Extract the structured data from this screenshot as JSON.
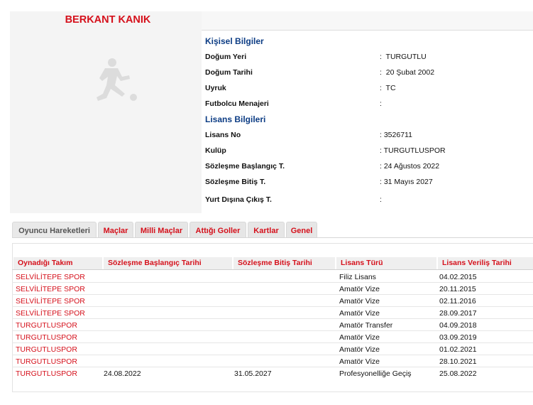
{
  "player": {
    "name": "BERKANT KANIK"
  },
  "personal": {
    "title": "Kişisel Bilgiler",
    "rows": [
      {
        "label": "Doğum Yeri",
        "value": ":  TURGUTLU"
      },
      {
        "label": "Doğum Tarihi",
        "value": ":  20 Şubat 2002"
      },
      {
        "label": "Uyruk",
        "value": ":  TC"
      },
      {
        "label": "Futbolcu Menajeri",
        "value": ":"
      }
    ]
  },
  "license": {
    "title": "Lisans Bilgileri",
    "rows": [
      {
        "label": "Lisans No",
        "value": ": 3526711"
      },
      {
        "label": "Kulüp",
        "value": ": TURGUTLUSPOR"
      },
      {
        "label": "Sözleşme Başlangıç T.",
        "value": ": 24 Ağustos 2022"
      },
      {
        "label": "Sözleşme Bitiş T.",
        "value": ": 31 Mayıs 2027"
      },
      {
        "label": "Yurt Dışına Çıkış T.",
        "value": ":"
      }
    ]
  },
  "tabs": [
    "Oyuncu Hareketleri",
    "Maçlar",
    "Milli Maçlar",
    "Attığı Goller",
    "Kartlar",
    "Genel"
  ],
  "table": {
    "headers": [
      "Oynadığı Takım",
      "Sözleşme Başlangıç Tarihi",
      "Sözleşme Bitiş Tarihi",
      "Lisans Türü",
      "Lisans Veriliş Tarihi"
    ],
    "rows": [
      [
        "SELVİLİTEPE SPOR",
        "",
        "",
        "Filiz Lisans",
        "04.02.2015"
      ],
      [
        "SELVİLİTEPE SPOR",
        "",
        "",
        "Amatör Vize",
        "20.11.2015"
      ],
      [
        "SELVİLİTEPE SPOR",
        "",
        "",
        "Amatör Vize",
        "02.11.2016"
      ],
      [
        "SELVİLİTEPE SPOR",
        "",
        "",
        "Amatör Vize",
        "28.09.2017"
      ],
      [
        "TURGUTLUSPOR",
        "",
        "",
        "Amatör Transfer",
        "04.09.2018"
      ],
      [
        "TURGUTLUSPOR",
        "",
        "",
        "Amatör Vize",
        "03.09.2019"
      ],
      [
        "TURGUTLUSPOR",
        "",
        "",
        "Amatör Vize",
        "01.02.2021"
      ],
      [
        "TURGUTLUSPOR",
        "",
        "",
        "Amatör Vize",
        "28.10.2021"
      ],
      [
        "TURGUTLUSPOR",
        "24.08.2022",
        "31.05.2027",
        "Profesyonelliğe Geçiş",
        "25.08.2022"
      ]
    ]
  }
}
